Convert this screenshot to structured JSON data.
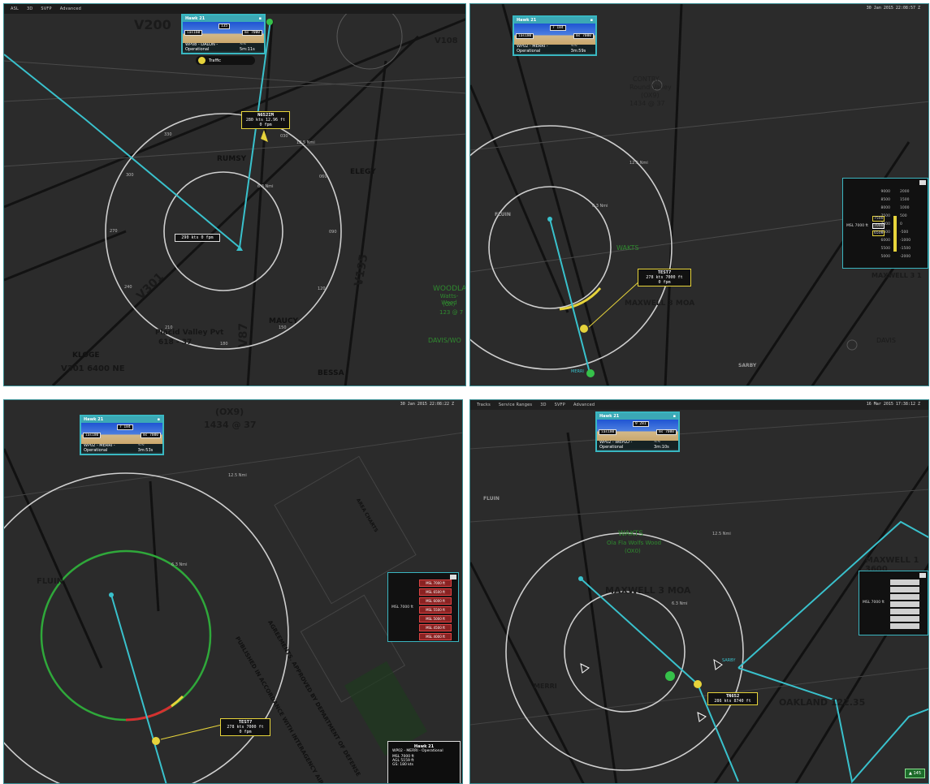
{
  "panels": [
    {
      "id": "top-left",
      "menu": [
        "ASL",
        "3D",
        "SVFP",
        "Advanced"
      ],
      "timestamp": "",
      "pfd": {
        "callsign": "Hawk 21",
        "alt_box": "135",
        "spd_box": "ias160",
        "rt_box": "ms 7000",
        "footer_left": "WP08 - DALON - Operational",
        "footer_right": "~~ 5m:11s"
      },
      "traffic_label": "Traffic",
      "tag": {
        "id": "N652IM",
        "line1": "280 kts  12.96 ft",
        "line2": "0 fpm"
      },
      "ownship_tag": "290 kts  0 fpm",
      "ring_labels": [
        "12.5 Nmi",
        "6.3 Nmi"
      ],
      "waypoints": [
        "RUMSY",
        "ELEGY",
        "KLOGE",
        "BESSA",
        "MAUCY"
      ],
      "airways": [
        "V200",
        "V301",
        "V87",
        "V195",
        "V108"
      ],
      "map_text": [
        "Placid Valley Pvt",
        "618 - 37",
        "V301 6400 NE",
        "WOODLA",
        "Watts-Wood",
        "(OX)",
        "123 @ 7",
        "DAVIS/WO"
      ],
      "degrees": [
        "330",
        "300",
        "270",
        "240",
        "030",
        "060",
        "090",
        "120",
        "150",
        "180",
        "210"
      ]
    },
    {
      "id": "top-right",
      "timestamp": "30 Jan 2015 22:08:57 Z",
      "pfd": {
        "callsign": "Hawk 21",
        "alt_box": "7 184",
        "spd_box": "ias180",
        "rt_box": "ms 7000",
        "footer_left": "WP02 - MERRI - Operational",
        "footer_right": "~~ 3m:59s"
      },
      "tag": {
        "id": "TEST7",
        "line1": "278 kts  7000 ft",
        "line2": "0 fpm"
      },
      "ring_labels": [
        "12.5 Nmi",
        "6.3 Nmi"
      ],
      "map_text": [
        "CONTRY",
        "Round Valley",
        "(OX9)",
        "1434 @ 37",
        "FLUIN",
        "MAXWELL 3 MOA",
        "WAKTS",
        "DAVIS",
        "SARBY",
        "MAXWELL 3 1",
        "MERRI"
      ],
      "altimeter": {
        "ticks": [
          "9000",
          "8500",
          "8000",
          "7500",
          "7000",
          "6500",
          "6000",
          "5500",
          "5000"
        ],
        "vs": [
          "2000",
          "1500",
          "1000",
          "500",
          "0",
          "-500",
          "-1000",
          "-1500",
          "-2000"
        ],
        "msl": "MSL 7000 ft",
        "sel": [
          "7500",
          "7000",
          "6500"
        ]
      }
    },
    {
      "id": "bottom-left",
      "timestamp": "30 Jan 2015 22:08:22 Z",
      "pfd": {
        "callsign": "Hawk 21",
        "alt_box": "7 184",
        "spd_box": "ias180",
        "rt_box": "ms 7000",
        "footer_left": "WP02 - MERRI - Operational",
        "footer_right": "~~ 3m:53s"
      },
      "tag": {
        "id": "TEST7",
        "line1": "278 kts  7000 ft",
        "line2": "0 fpm"
      },
      "ring_labels": [
        "12.5 Nmi",
        "6.3 Nmi"
      ],
      "map_text": [
        "(OX9)",
        "1434 @ 37",
        "FLUIN",
        "PUBLISHED IN ACCORDANCE WITH INTERAGENCY AIR",
        "AGREEMENTS. APPROVED BY DEPARTMENT OF DEFENSE",
        "AREA CHARTS"
      ],
      "alt_slots": [
        "MSL 7000 ft",
        "MSL 6500 ft",
        "MSL 6000 ft",
        "MSL 5500 ft",
        "MSL 5000 ft",
        "MSL 4500 ft",
        "MSL 4000 ft"
      ],
      "alt_label": "MSL 7000 ft",
      "info": {
        "title": "Hawk 21",
        "nav": "WP02 - MERRI - Operational",
        "msl": "MSL 7000 ft",
        "agl": "AGL 5159 ft",
        "gs": "GS: 180 kts"
      }
    },
    {
      "id": "bottom-right",
      "menu": [
        "Tracks",
        "Service Ranges",
        "3D",
        "SVFP",
        "Advanced"
      ],
      "timestamp": "16 Mar 2015 17:38:12 Z",
      "pfd": {
        "callsign": "Hawk 21",
        "alt_box": "9 281",
        "spd_box": "ias180",
        "rt_box": "ms 7000",
        "footer_left": "WP02 - WEPLO - Operational",
        "footer_right": "~~ 3m:10s"
      },
      "tag": {
        "id": "TN652",
        "line1": "286 kts  8740 ft",
        "line2": ""
      },
      "ring_labels": [
        "12.5 Nmi",
        "6.3 Nmi"
      ],
      "map_text": [
        "WAKTS",
        "Ola Fla Wolfs Wood",
        "(OX0)",
        "MAXWELL 3 MOA",
        "MAXWELL 1 3600",
        "MERRI",
        "SARBY",
        "OAKLAND 122.35",
        "FLUIN"
      ],
      "alt_label": "MSL 7000 ft",
      "badge": "145"
    }
  ]
}
